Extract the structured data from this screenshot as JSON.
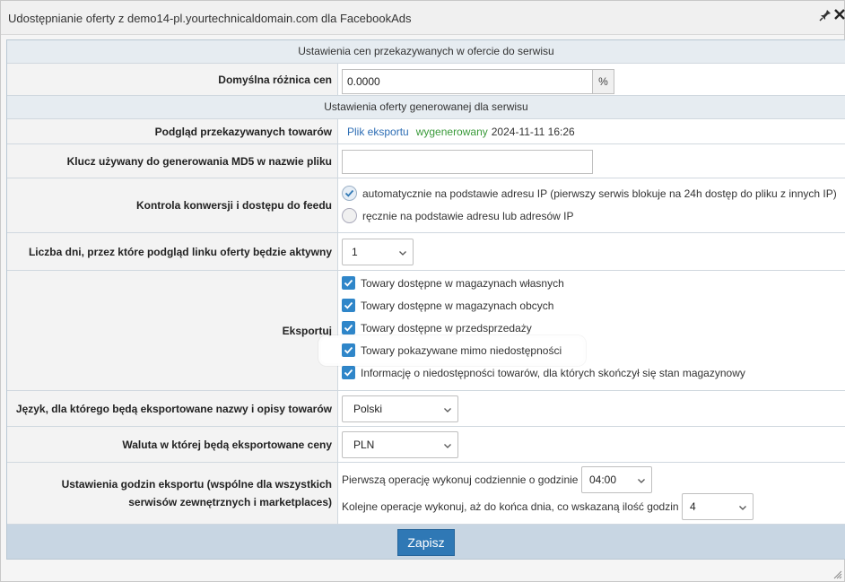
{
  "dialog": {
    "title": "Udostępnianie oferty z demo14-pl.yourtechnicaldomain.com dla FacebookAds"
  },
  "sections": {
    "prices_header": "Ustawienia cen przekazywanych w ofercie do serwisu",
    "offer_header": "Ustawienia oferty generowanej dla serwisu"
  },
  "price_diff": {
    "label": "Domyślna różnica cen",
    "value": "0.0000",
    "unit": "%"
  },
  "preview": {
    "label": "Podgląd przekazywanych towarów",
    "link": "Plik eksportu",
    "status": "wygenerowany",
    "datetime": "2024-11-11 16:26"
  },
  "md5": {
    "label": "Klucz używany do generowania MD5 w nazwie pliku",
    "value": ""
  },
  "access": {
    "label": "Kontrola konwersji i dostępu do feedu",
    "options": [
      {
        "label": "automatycznie na podstawie adresu IP (pierwszy serwis blokuje na 24h dostęp do pliku z innych IP)",
        "selected": true
      },
      {
        "label": "ręcznie na podstawie adresu lub adresów IP",
        "selected": false
      }
    ]
  },
  "days": {
    "label": "Liczba dni, przez które podgląd linku oferty będzie aktywny",
    "value": "1"
  },
  "export": {
    "label": "Eksportuj",
    "items": [
      {
        "label": "Towary dostępne w magazynach własnych",
        "checked": true
      },
      {
        "label": "Towary dostępne w magazynach obcych",
        "checked": true
      },
      {
        "label": "Towary dostępne w przedsprzedaży",
        "checked": true
      },
      {
        "label": "Towary pokazywane mimo niedostępności",
        "checked": true
      },
      {
        "label": "Informację o niedostępności towarów, dla których skończył się stan magazynowy",
        "checked": true
      }
    ]
  },
  "language": {
    "label": "Język, dla którego będą eksportowane nazwy i opisy towarów",
    "value": "Polski"
  },
  "currency": {
    "label": "Waluta w której będą eksportowane ceny",
    "value": "PLN"
  },
  "hours": {
    "label_line1": "Ustawienia godzin eksportu (wspólne dla wszystkich",
    "label_line2": "serwisów zewnętrznych i marketplaces)",
    "first_label": "Pierwszą operację wykonuj codziennie o godzinie",
    "first_value": "04:00",
    "next_label": "Kolejne operacje wykonuj, aż do końca dnia, co wskazaną ilość godzin",
    "next_value": "4"
  },
  "actions": {
    "save": "Zapisz"
  },
  "colors": {
    "accent": "#2f78b5",
    "checkbox": "#2f86c9",
    "success": "#3a9a3a",
    "link": "#2f6fb5"
  }
}
